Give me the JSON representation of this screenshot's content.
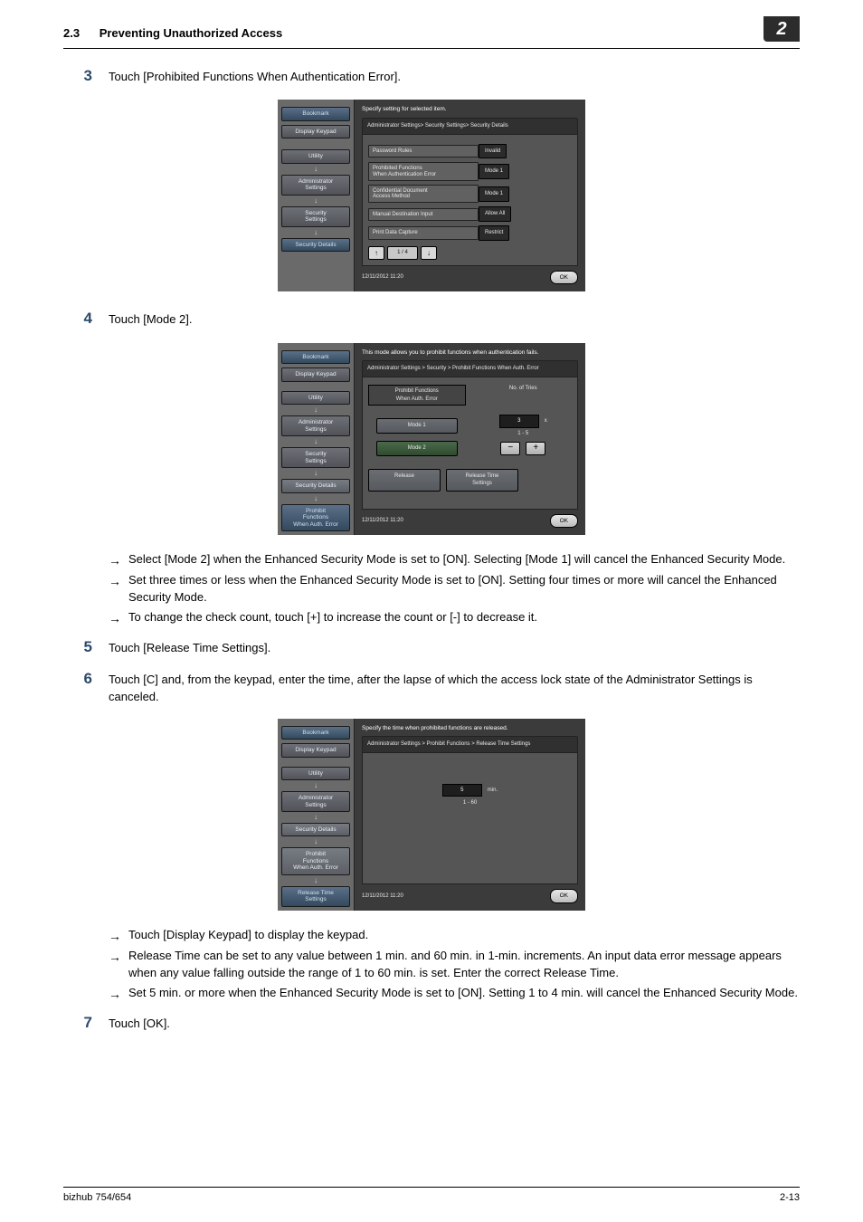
{
  "header": {
    "section_no": "2.3",
    "section_title": "Preventing Unauthorized Access",
    "chapter_badge": "2"
  },
  "steps": {
    "s3": {
      "num": "3",
      "text": "Touch [Prohibited Functions When Authentication Error]."
    },
    "s4": {
      "num": "4",
      "text": "Touch [Mode 2]."
    },
    "s4_b1": "Select [Mode 2] when the Enhanced Security Mode is set to [ON]. Selecting [Mode 1] will cancel the Enhanced Security Mode.",
    "s4_b2": "Set three times or less when the Enhanced Security Mode is set to [ON]. Setting four times or more will cancel the Enhanced Security Mode.",
    "s4_b3": "To change the check count, touch [+] to increase the count or [-] to decrease it.",
    "s5": {
      "num": "5",
      "text": "Touch [Release Time Settings]."
    },
    "s6": {
      "num": "6",
      "text": "Touch [C] and, from the keypad, enter the time, after the lapse of which the access lock state of the Administrator Settings is canceled."
    },
    "s6_b1": "Touch [Display Keypad] to display the keypad.",
    "s6_b2": "Release Time can be set to any value between 1 min. and 60 min. in 1-min. increments. An input data error message appears when any value falling outside the range of 1 to 60 min. is set. Enter the correct Release Time.",
    "s6_b3": "Set 5 min. or more when the Enhanced Security Mode is set to [ON]. Setting 1 to 4 min. will cancel the Enhanced Security Mode.",
    "s7": {
      "num": "7",
      "text": "Touch [OK]."
    }
  },
  "screen1": {
    "msg": "Specify setting for selected item.",
    "crumb": "Administrator Settings> Security Settings> Security Details",
    "side": {
      "bookmark": "Bookmark",
      "keypad": "Display Keypad",
      "utility": "Utility",
      "admin": "Administrator\nSettings",
      "sec": "Security\nSettings",
      "secd": "Security Details"
    },
    "rows": {
      "r1l": "Password Rules",
      "r1v": "Invalid",
      "r2l": "Prohibited Functions\nWhen Authentication Error",
      "r2v": "Mode 1",
      "r3l": "Confidential Document\nAccess Method",
      "r3v": "Mode 1",
      "r4l": "Manual Destination Input",
      "r4v": "Allow All",
      "r5l": "Print Data Capture",
      "r5v": "Restrict"
    },
    "pageind": "1 / 4",
    "timestamp": "12/11/2012   11:20",
    "ok": "OK"
  },
  "screen2": {
    "msg": "This mode allows you to prohibit functions when authentication fails.",
    "crumb": "Administrator Settings > Security > Prohibit Functions When Auth. Error",
    "side": {
      "bookmark": "Bookmark",
      "keypad": "Display Keypad",
      "utility": "Utility",
      "admin": "Administrator\nSettings",
      "sec": "Security\nSettings",
      "secd": "Security Details",
      "prohib": "Prohibit\nFunctions\nWhen Auth. Error"
    },
    "head_left": "Prohibit Functions\nWhen Auth. Error",
    "head_right": "No. of Tries",
    "mode1": "Mode 1",
    "mode2": "Mode 2",
    "count": "3",
    "count_unit": "x",
    "range": "1  -  5",
    "release": "Release",
    "release_time": "Release Time\nSettings",
    "timestamp": "12/11/2012   11:20",
    "ok": "OK"
  },
  "screen3": {
    "msg": "Specify the time when prohibited functions are released.",
    "crumb": "Administrator Settings > Prohibit Functions > Release Time Settings",
    "side": {
      "bookmark": "Bookmark",
      "keypad": "Display Keypad",
      "utility": "Utility",
      "admin": "Administrator\nSettings",
      "secd": "Security Details",
      "prohib": "Prohibit\nFunctions\nWhen Auth. Error",
      "rts": "Release Time\nSettings"
    },
    "value": "5",
    "unit": "min.",
    "range": "1  -  60",
    "timestamp": "12/11/2012   11:20",
    "ok": "OK"
  },
  "footer": {
    "left": "bizhub 754/654",
    "right": "2-13"
  },
  "glyphs": {
    "arrow": "→",
    "down": "↓",
    "up": "↑",
    "minus": "−",
    "plus": "+"
  }
}
